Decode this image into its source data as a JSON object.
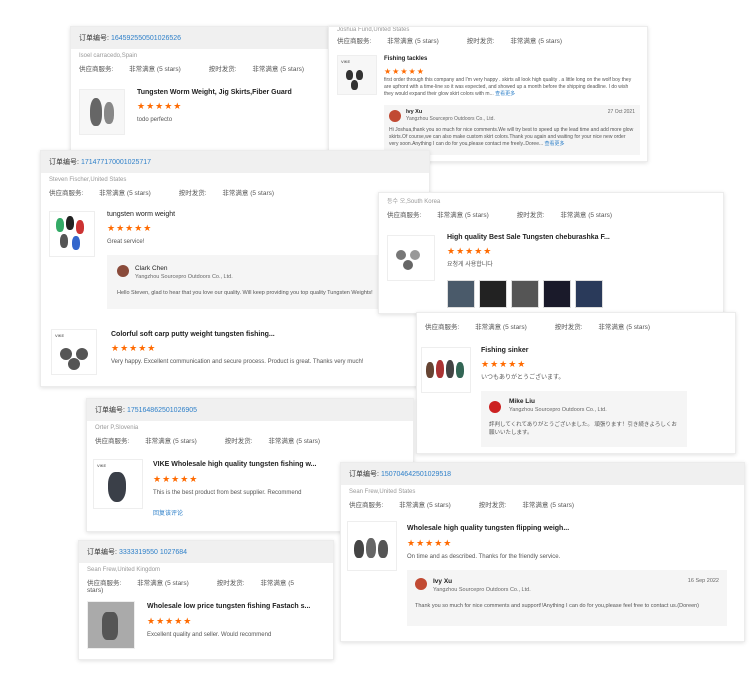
{
  "labels": {
    "order_no": "订单编号:",
    "supplier": "供应商服务:",
    "shipping": "按时发货:",
    "very_satisfied": "非常满意 (5 stars)"
  },
  "cards": [
    {
      "order": "164592550501026526",
      "buyer": "Isoel carracedo,Spain",
      "title": "Tungsten Worm Weight, Jig Skirts,Fiber Guard",
      "stars": "★★★★★",
      "text": "todo perfecto"
    },
    {
      "order": "",
      "buyer": "Joshua Fund,United States",
      "title": "Fishing tackles",
      "stars": "★★★★★",
      "text": "first order through this company and I'm very happy . skirts all look high quality . a little long on the wolf boy they are upfront with a time-line so it was expected, and showed up a month before the shipping deadline. I do wish they would expand their glow skirt colors with m...",
      "more": "查看更多",
      "reply": {
        "name": "Ivy Xu",
        "company": "Yangzhou Sourcepro Outdoors Co., Ltd.",
        "date": "27 Oct 2021",
        "text": "Hi Joshua,thank you so much for nice comments.We will try best to speed up the lead time and add more glow skirts.Of course,we can also make custom skirt colors.Thank you again and waiting for your nice new order very soon.Anything I can do for you,please contact me freely..Doree...",
        "more": "查看更多"
      }
    },
    {
      "order": "171477170001025717",
      "buyer": "Steven Fischer,United States",
      "title": "tungsten worm weight",
      "stars": "★★★★★",
      "text": "Great service!",
      "reply": {
        "name": "Clark Chen",
        "company": "Yangzhou Sourcepro Outdoors Co., Ltd.",
        "text": "Hello Steven, glad to hear that you love our quality. Will keep providing you top quality Tungsten Weights!"
      },
      "title2": "Colorful soft carp putty weight tungsten fishing...",
      "stars2": "★★★★★",
      "text2": "Very happy. Excellent communication and secure process. Product is great. Thanks very much!"
    },
    {
      "order": "",
      "buyer": "등수 오,South Korea",
      "title": "High quality Best Sale Tungsten cheburashka F...",
      "stars": "★★★★★",
      "text": "요청게 사용합니다"
    },
    {
      "order": "",
      "buyer": "",
      "title": "Fishing sinker",
      "stars": "★★★★★",
      "text": "いつもありがとうございます。",
      "reply": {
        "name": "Mike Liu",
        "company": "Yangzhou Sourcepro Outdoors Co., Ltd.",
        "text": "評判してくれてありがとうございました。 頑張ります！引き続きよろしくお願いいたします。"
      }
    },
    {
      "order": "175164862501026905",
      "buyer": "Orter P,Slovenia",
      "title": "VIKE Wholesale high quality tungsten fishing w...",
      "stars": "★★★★★",
      "text": "This is the best product from best supplier. Recommend",
      "more": "回复该评论"
    },
    {
      "order": "150704642501029518",
      "buyer": "Sean Frew,United States",
      "title": "Wholesale high quality tungsten flipping weigh...",
      "stars": "★★★★★",
      "text": "On time and as described. Thanks for the friendly service.",
      "reply": {
        "name": "Ivy Xu",
        "company": "Yangzhou Sourcepro Outdoors Co., Ltd.",
        "date": "16 Sep 2022",
        "text": "Thank you so much for nice comments and support!!Anything I can do for you,please feel free to contact us.(Doreen)"
      }
    },
    {
      "order": "3333319550 1027684",
      "buyer": "Sean Frew,United Kingdom",
      "title": "Wholesale low price tungsten fishing Fastach s...",
      "stars": "★★★★★",
      "text": "Excellent quality and seller. Would recommend"
    }
  ],
  "colors": {
    "star": "#ff6a00",
    "link": "#2f80c9",
    "header_bg": "#f0f0f0"
  }
}
